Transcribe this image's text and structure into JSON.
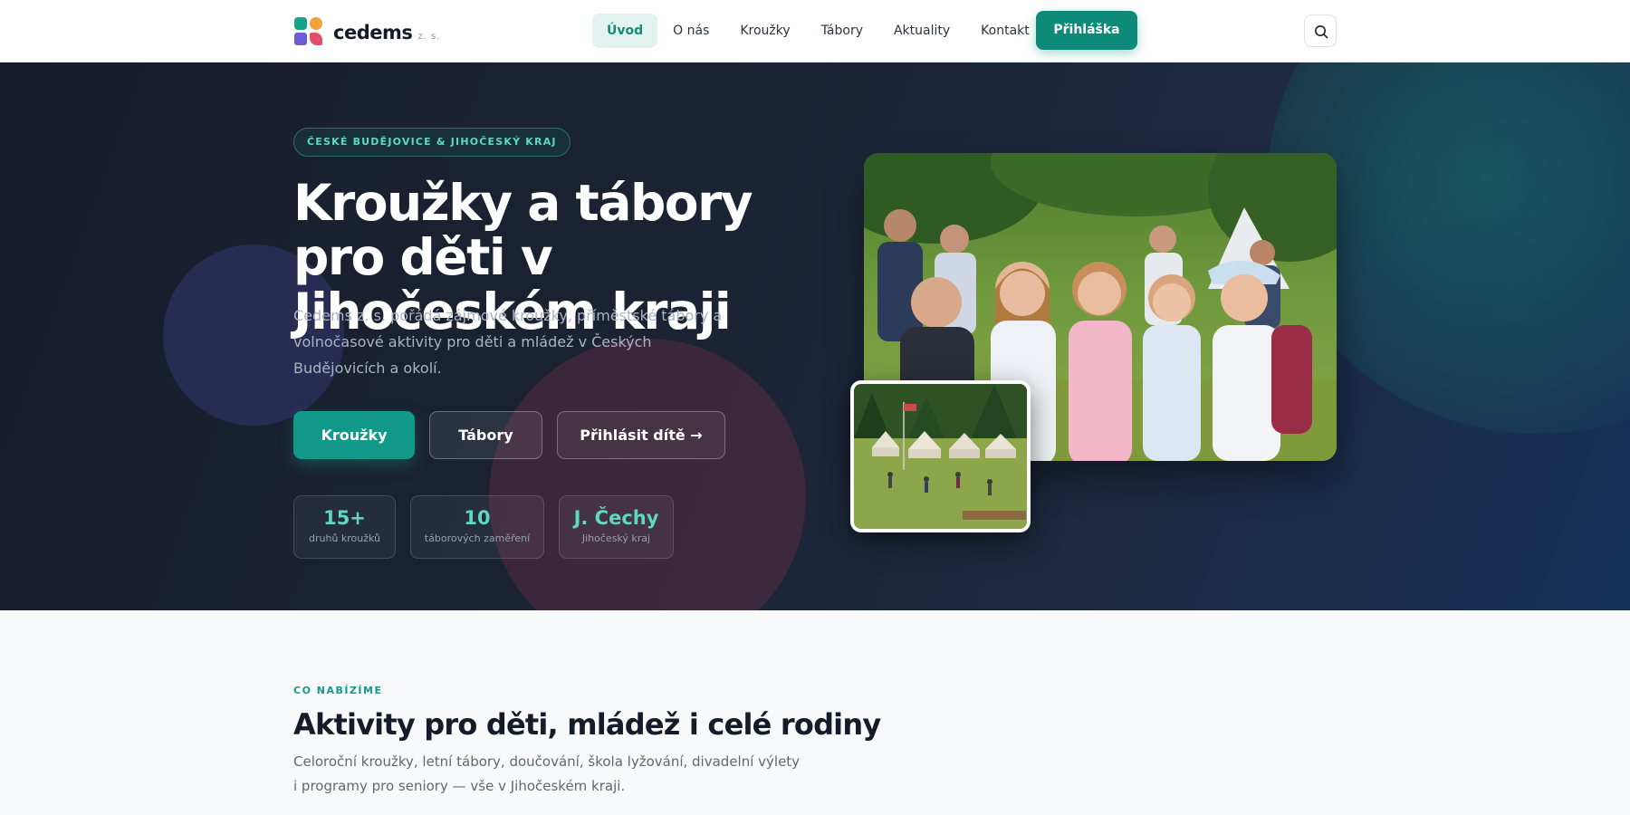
{
  "brand": {
    "name": "cedems",
    "suffix": "z. s."
  },
  "nav": {
    "items": [
      "Úvod",
      "O nás",
      "Kroužky",
      "Tábory",
      "Aktuality",
      "Kontakt"
    ],
    "active_index": 0,
    "cta_label": "Přihláška"
  },
  "hero": {
    "badge": "ČESKÉ BUDĚJOVICE & JIHOČESKÝ KRAJ",
    "title": "Kroužky a tábory pro děti v Jihočeském kraji",
    "description": "Cedems z. s. pořádá zájmové kroužky, příměstské tábory a volnočasové aktivity pro děti a mládež v Českých Budějovicích a okolí.",
    "buttons": {
      "primary": "Kroužky",
      "secondary": "Tábory",
      "outline": "Přihlásit dítě →"
    },
    "stats": [
      {
        "value": "15+",
        "label": "druhů kroužků"
      },
      {
        "value": "10",
        "label": "táborových zaměření"
      },
      {
        "value": "J. Čechy",
        "label": "Jihočeský kraj"
      }
    ]
  },
  "section": {
    "eyebrow": "CO NABÍZÍME",
    "title": "Aktivity pro děti, mládež i celé rodiny",
    "description": "Celoroční kroužky, letní tábory, doučování, škola lyžování, divadelní výlety i programy pro seniory — vše v Jihočeském kraji."
  },
  "colors": {
    "accent": "#13998a",
    "accent_text": "#5fd8c0",
    "hero_bg": "#1b2333"
  },
  "icons": {
    "search": "search-icon"
  }
}
